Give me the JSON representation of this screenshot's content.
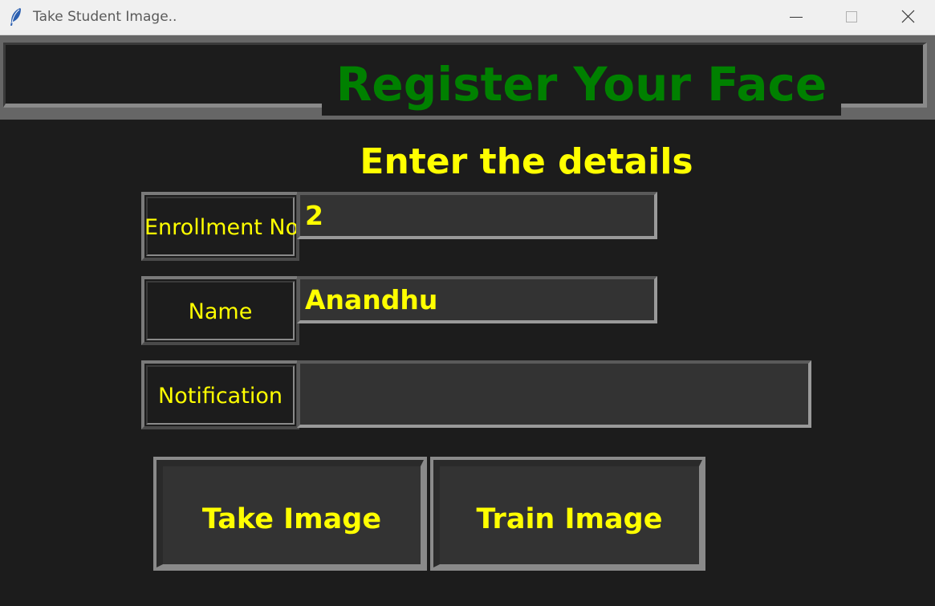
{
  "window": {
    "title": "Take Student Image..",
    "icon": "feather-icon",
    "controls": {
      "minimize": "minimize-icon",
      "maximize": "maximize-icon",
      "close": "close-icon"
    }
  },
  "header": {
    "title": "Register Your Face",
    "title_color": "#008000"
  },
  "form": {
    "subtitle": "Enter the details",
    "text_color": "#ffff00",
    "fields": [
      {
        "label": "Enrollment No",
        "value": "2"
      },
      {
        "label": "Name",
        "value": "Anandhu"
      },
      {
        "label": "Notification",
        "value": ""
      }
    ]
  },
  "buttons": {
    "take_image": "Take Image",
    "train_image": "Train Image"
  },
  "colors": {
    "background": "#1c1c1c",
    "entry_background": "#333333",
    "border": "#8a8a8a"
  }
}
